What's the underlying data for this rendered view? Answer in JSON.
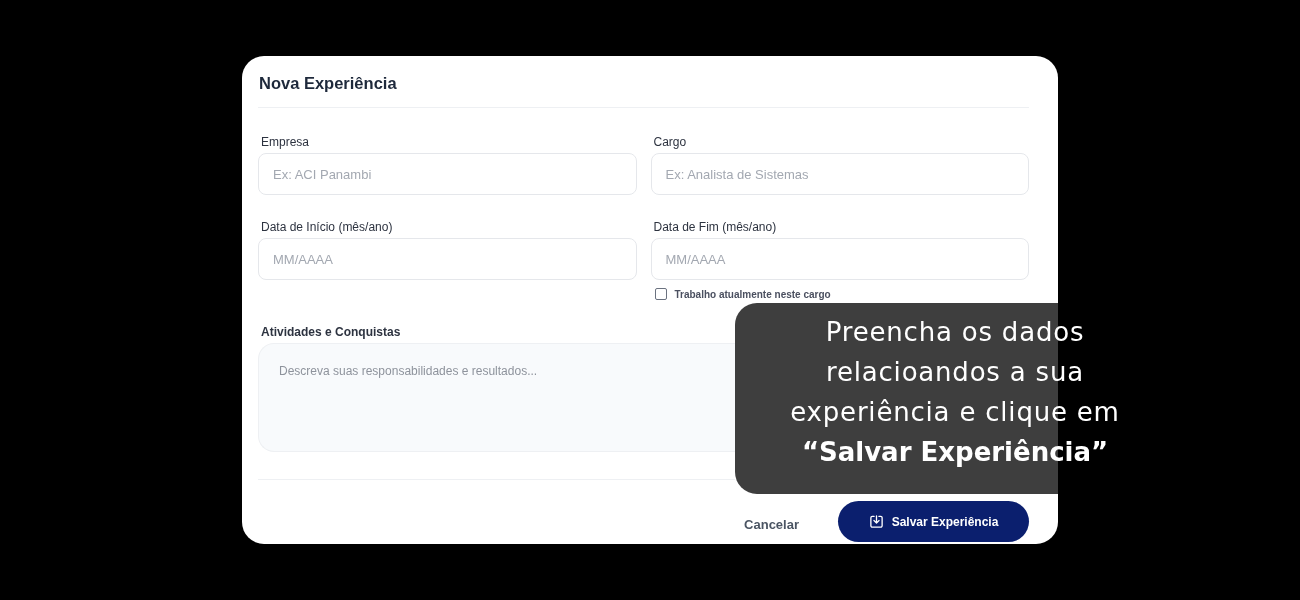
{
  "dialog": {
    "title": "Nova Experiência"
  },
  "fields": [
    {
      "label": "Empresa",
      "placeholder": "Ex: ACI Panambi"
    },
    {
      "label": "Cargo",
      "placeholder": "Ex: Analista de Sistemas"
    },
    {
      "label": "Data de Início (mês/ano)",
      "placeholder": "MM/AAAA"
    },
    {
      "label": "Data de Fim (mês/ano)",
      "placeholder": "MM/AAAA",
      "checkbox": {
        "label": "Trabalho atualmente neste cargo",
        "checked": false
      }
    }
  ],
  "activities": {
    "label": "Atividades e Conquistas",
    "placeholder": "Descreva suas responsabilidades e resultados..."
  },
  "actions": [
    {
      "kind": "secondary",
      "label": "Cancelar"
    },
    {
      "kind": "primary",
      "label": "Salvar Experiência"
    }
  ],
  "callout": {
    "text": "Preencha os dados\nrelacioandos a sua\nexperiência e clique em\n**“Salvar Experiência”**"
  }
}
